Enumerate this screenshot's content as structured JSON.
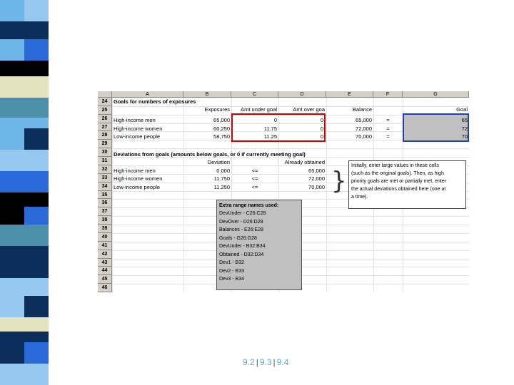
{
  "stripe_colors": {
    "light_blue": "#6fb6e8",
    "navy": "#0b2e5c",
    "black": "#000000",
    "cream": "#e4e3bf",
    "teal": "#4d8faa",
    "royal": "#2a6ad8",
    "sky": "#97c8ef"
  },
  "columns": [
    "A",
    "B",
    "C",
    "D",
    "E",
    "F",
    "G"
  ],
  "rows": [
    "24",
    "25",
    "26",
    "27",
    "28",
    "29",
    "30",
    "31",
    "32",
    "33",
    "34",
    "35",
    "36",
    "37",
    "38",
    "39",
    "40",
    "41",
    "42",
    "43",
    "44",
    "45",
    "46"
  ],
  "sheet": {
    "title1": "Goals for numbers of exposures",
    "h_exposures": "Exposures",
    "h_amt_under": "Amt under goal",
    "h_amt_over": "Amt over goa",
    "h_balance": "Balance",
    "h_goal": "Goal",
    "r26": {
      "label": "High-income men",
      "exp": "65,000",
      "under": "0",
      "over": "0",
      "bal": "65,000",
      "op": "=",
      "goal": "65"
    },
    "r27": {
      "label": "High-income women",
      "exp": "60,250",
      "under": "11.75",
      "over": "0",
      "bal": "72,000",
      "op": "=",
      "goal": "72"
    },
    "r28": {
      "label": "Low-income people",
      "exp": "58,750",
      "under": "11.25",
      "over": "0",
      "bal": "70,000",
      "op": "=",
      "goal": "70"
    },
    "title2": "Deviations from goals (amounts below goals, or 0 if currently meeting goal)",
    "h_deviation": "Deviation",
    "h_already": "Already obtained",
    "r32": {
      "label": "High-income men",
      "dev": "0.000",
      "op": "<=",
      "obt": "65,000"
    },
    "r33": {
      "label": "High-income women",
      "dev": "11.750",
      "op": "<=",
      "obt": "72,000"
    },
    "r34": {
      "label": "Low-income people",
      "dev": "11.250",
      "op": "<=",
      "obt": "70,000"
    }
  },
  "note_lines": [
    "Initially, enter large values in these cells",
    "(such as the original goals). Then, as high",
    "priority goals are met or partially met, enter",
    "the actual deviations obtained here (one at",
    "a time)."
  ],
  "extra": {
    "title": "Extra range names used:",
    "items": [
      "DevUnder - C26:C28",
      "DevOver - D26:D28",
      "Balances - E26:E28",
      "Goals - G26:G28",
      "DevUnder - B32:B34",
      "Obtained - D32:D34",
      "Dev1 - B32",
      "Dev2 - B33",
      "Dev3 - B34"
    ]
  },
  "footer": {
    "link1": "9.2",
    "link2": "9.3",
    "link3": "9.4",
    "sep": "|"
  }
}
